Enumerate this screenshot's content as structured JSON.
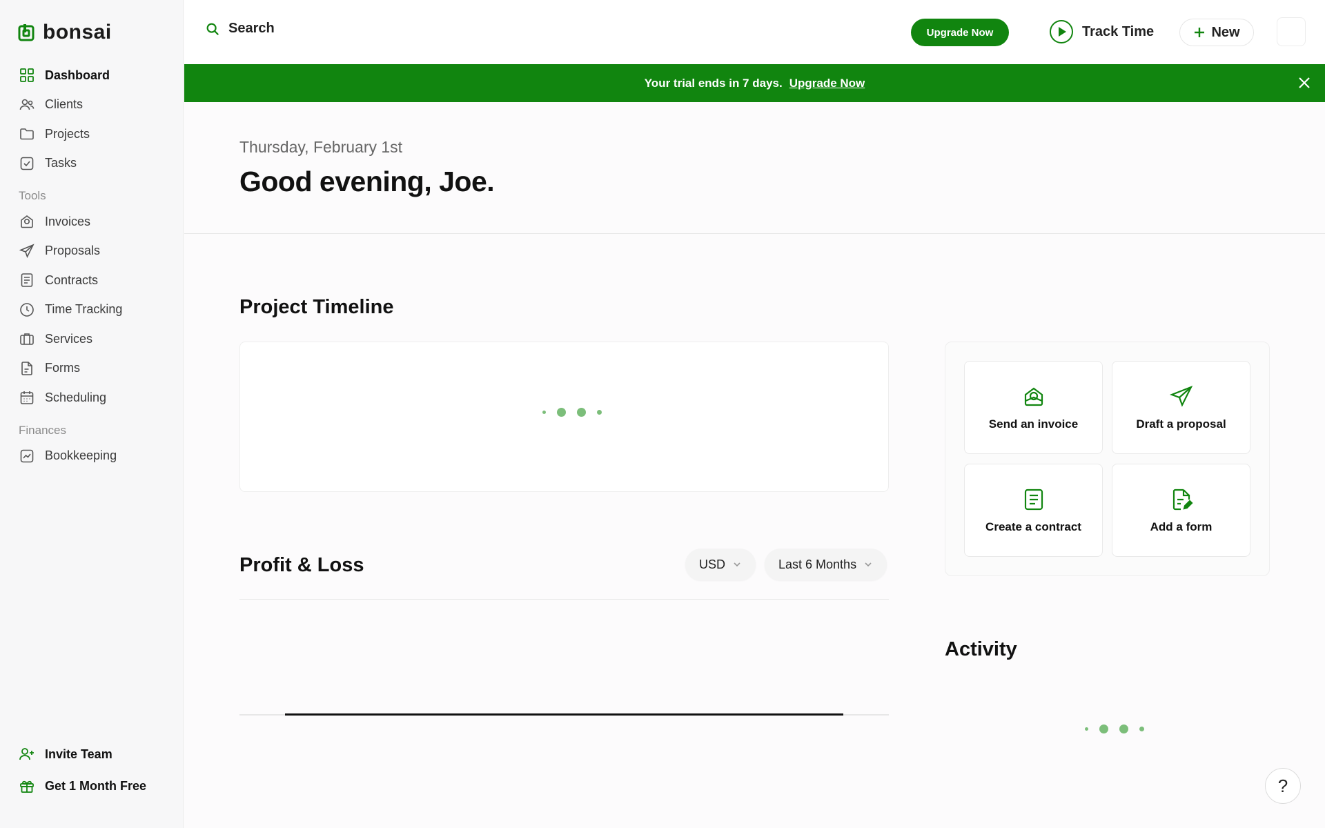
{
  "app": {
    "name": "bonsai",
    "brand_color": "#11850f"
  },
  "sidebar": {
    "items": [
      {
        "label": "Dashboard",
        "icon": "dashboard-grid-icon",
        "active": true
      },
      {
        "label": "Clients",
        "icon": "users-icon"
      },
      {
        "label": "Projects",
        "icon": "folder-icon"
      },
      {
        "label": "Tasks",
        "icon": "checkbox-icon"
      }
    ],
    "tools_heading": "Tools",
    "tools": [
      {
        "label": "Invoices",
        "icon": "invoice-icon"
      },
      {
        "label": "Proposals",
        "icon": "paper-plane-icon"
      },
      {
        "label": "Contracts",
        "icon": "document-icon"
      },
      {
        "label": "Time Tracking",
        "icon": "clock-icon"
      },
      {
        "label": "Services",
        "icon": "briefcase-icon"
      },
      {
        "label": "Forms",
        "icon": "form-icon"
      },
      {
        "label": "Scheduling",
        "icon": "calendar-icon"
      }
    ],
    "finances_heading": "Finances",
    "finances": [
      {
        "label": "Bookkeeping",
        "icon": "chart-icon"
      }
    ],
    "bottom": [
      {
        "label": "Invite Team",
        "icon": "add-user-icon"
      },
      {
        "label": "Get 1 Month Free",
        "icon": "gift-icon"
      }
    ]
  },
  "topbar": {
    "search_label": "Search",
    "upgrade_label": "Upgrade Now",
    "track_time_label": "Track Time",
    "new_label": "New"
  },
  "banner": {
    "text": "Your trial ends in 7 days.",
    "link": "Upgrade Now"
  },
  "greeting": {
    "date": "Thursday, February 1st",
    "message": "Good evening, Joe."
  },
  "project_timeline": {
    "title": "Project Timeline"
  },
  "quick_actions": [
    {
      "label": "Send an invoice",
      "icon": "invoice-icon"
    },
    {
      "label": "Draft a proposal",
      "icon": "paper-plane-icon"
    },
    {
      "label": "Create a contract",
      "icon": "document-icon"
    },
    {
      "label": "Add a form",
      "icon": "form-edit-icon"
    }
  ],
  "profit_loss": {
    "title": "Profit & Loss",
    "currency": "USD",
    "range": "Last 6 Months"
  },
  "activity": {
    "title": "Activity"
  },
  "help": {
    "label": "?"
  }
}
